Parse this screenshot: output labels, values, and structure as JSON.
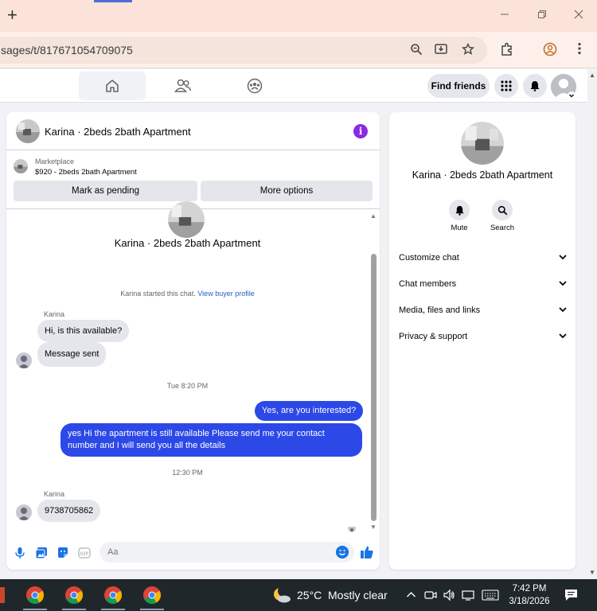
{
  "browser": {
    "new_tab_symbol": "+",
    "url": "sages/t/817671054709075",
    "window_controls": [
      "minimize",
      "restore",
      "close"
    ]
  },
  "fb_nav": {
    "tabs": [
      "home-icon",
      "friends-icon",
      "groups-icon"
    ],
    "find_friends": "Find friends"
  },
  "chat": {
    "header_name": "Karina · 2beds 2bath Apartment",
    "marketplace_label": "Marketplace",
    "listing": "$920 - 2beds 2bath Apartment",
    "mark_pending": "Mark as pending",
    "more_options": "More options",
    "conv_title": "Karina · 2beds 2bath Apartment",
    "started_text": "Karina started this chat.",
    "view_buyer_profile": "View buyer profile",
    "sender1": "Karina",
    "msg1": "Hi, is this available?",
    "msg2": "Message sent",
    "time1": "Tue 8:20 PM",
    "out1": "Yes, are you interested?",
    "out2": "yes Hi the apartment is still available Please send me your contact number and I will send you all the details",
    "time2": "12:30 PM",
    "sender2": "Karina",
    "msg3": "9738705862",
    "input_placeholder": "Aa"
  },
  "info_panel": {
    "title": "Karina · 2beds 2bath Apartment",
    "mute": "Mute",
    "search": "Search",
    "sections": [
      "Customize chat",
      "Chat members",
      "Media, files and links",
      "Privacy & support"
    ]
  },
  "taskbar": {
    "temperature": "25°C",
    "weather": "Mostly clear",
    "time": "7:42 PM",
    "date": "3/18/2026"
  },
  "colors": {
    "accent_blue": "#2c49e8",
    "messenger_purple": "#8a2be2",
    "titlebar": "#fbe3d9"
  }
}
